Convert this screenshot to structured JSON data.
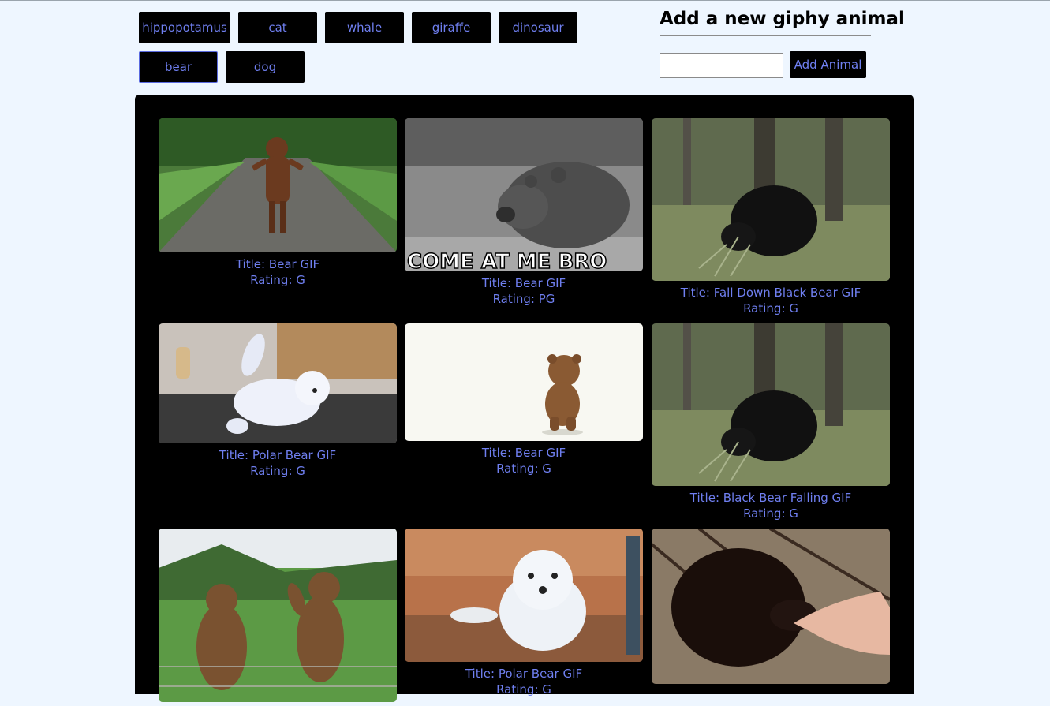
{
  "animals": [
    "hippopotamus",
    "cat",
    "whale",
    "giraffe",
    "dinosaur",
    "bear",
    "dog"
  ],
  "active_animal": "bear",
  "form": {
    "title": "Add a new giphy animal",
    "input_value": "",
    "button_label": "Add Animal"
  },
  "gifs": [
    {
      "title": "Title: Bear GIF",
      "rating": "Rating: G",
      "image": "person in bear costume dancing on road"
    },
    {
      "title": "Title: Bear GIF",
      "rating": "Rating: PG",
      "image": "grayscale bear walking toward camera",
      "overlay_text": "COME AT ME BRO"
    },
    {
      "title": "Title: Fall Down Black Bear GIF",
      "rating": "Rating: G",
      "image": "black bear in forest"
    },
    {
      "title": "Title: Polar Bear GIF",
      "rating": "Rating: G",
      "image": "polar bear cub on table"
    },
    {
      "title": "Title: Bear GIF",
      "rating": "Rating: G",
      "image": "teddy bear walking away"
    },
    {
      "title": "Title: Black Bear Falling GIF",
      "rating": "Rating: G",
      "image": "black bear in forest"
    },
    {
      "title": "",
      "rating": "",
      "image": "two brown bears waving in grassy field"
    },
    {
      "title": "Title: Polar Bear GIF",
      "rating": "Rating: G",
      "image": "polar bear cub at glass"
    },
    {
      "title": "",
      "rating": "",
      "image": "black bear cub eating from hand"
    }
  ]
}
